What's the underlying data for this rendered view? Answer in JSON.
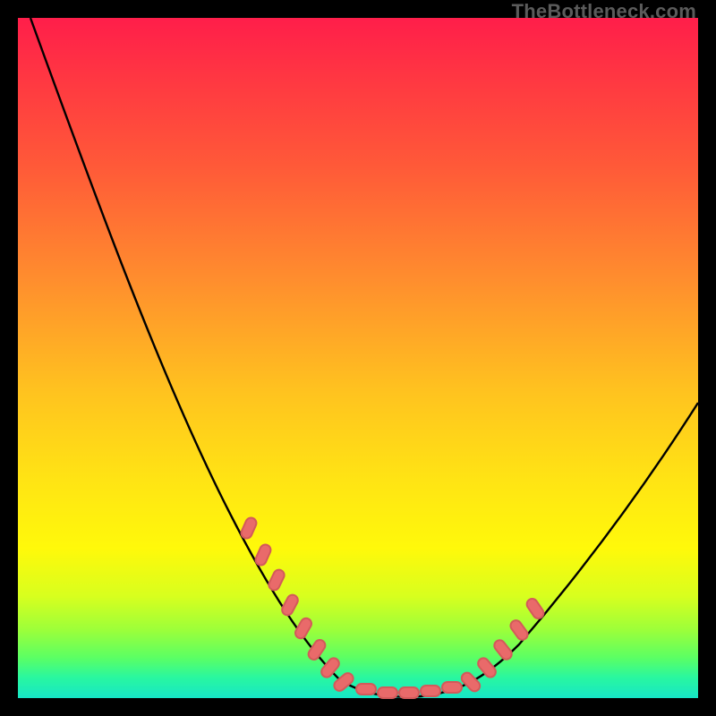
{
  "watermark": "TheBottleneck.com",
  "colors": {
    "accent_stroke": "#000000",
    "marker_fill": "#e96a6a",
    "marker_stroke": "#d35a5a"
  },
  "chart_data": {
    "type": "line",
    "title": "",
    "xlabel": "",
    "ylabel": "",
    "x": [
      0.0,
      0.02,
      0.05,
      0.1,
      0.15,
      0.2,
      0.25,
      0.3,
      0.35,
      0.4,
      0.45,
      0.5,
      0.55,
      0.6,
      0.65,
      0.7,
      0.75,
      0.8,
      0.85,
      0.9,
      0.95,
      1.0
    ],
    "series": [
      {
        "name": "curve",
        "values": [
          1.0,
          0.95,
          0.88,
          0.76,
          0.64,
          0.52,
          0.41,
          0.3,
          0.2,
          0.12,
          0.06,
          0.02,
          0.003,
          0.0,
          0.003,
          0.02,
          0.06,
          0.12,
          0.2,
          0.29,
          0.38,
          0.47
        ]
      }
    ],
    "xlim": [
      0,
      1
    ],
    "ylim": [
      0,
      1
    ],
    "markers_left": {
      "x": [
        0.34,
        0.36,
        0.38,
        0.4,
        0.42,
        0.44,
        0.46,
        0.48
      ],
      "y": [
        0.24,
        0.2,
        0.16,
        0.12,
        0.09,
        0.06,
        0.04,
        0.02
      ]
    },
    "markers_right": {
      "x": [
        0.66,
        0.68,
        0.7,
        0.72,
        0.74
      ],
      "y": [
        0.015,
        0.03,
        0.05,
        0.08,
        0.11
      ]
    },
    "markers_bottom": {
      "x": [
        0.5,
        0.53,
        0.56,
        0.59,
        0.62
      ],
      "y": [
        0.002,
        0.001,
        0.0,
        0.001,
        0.003
      ]
    }
  }
}
